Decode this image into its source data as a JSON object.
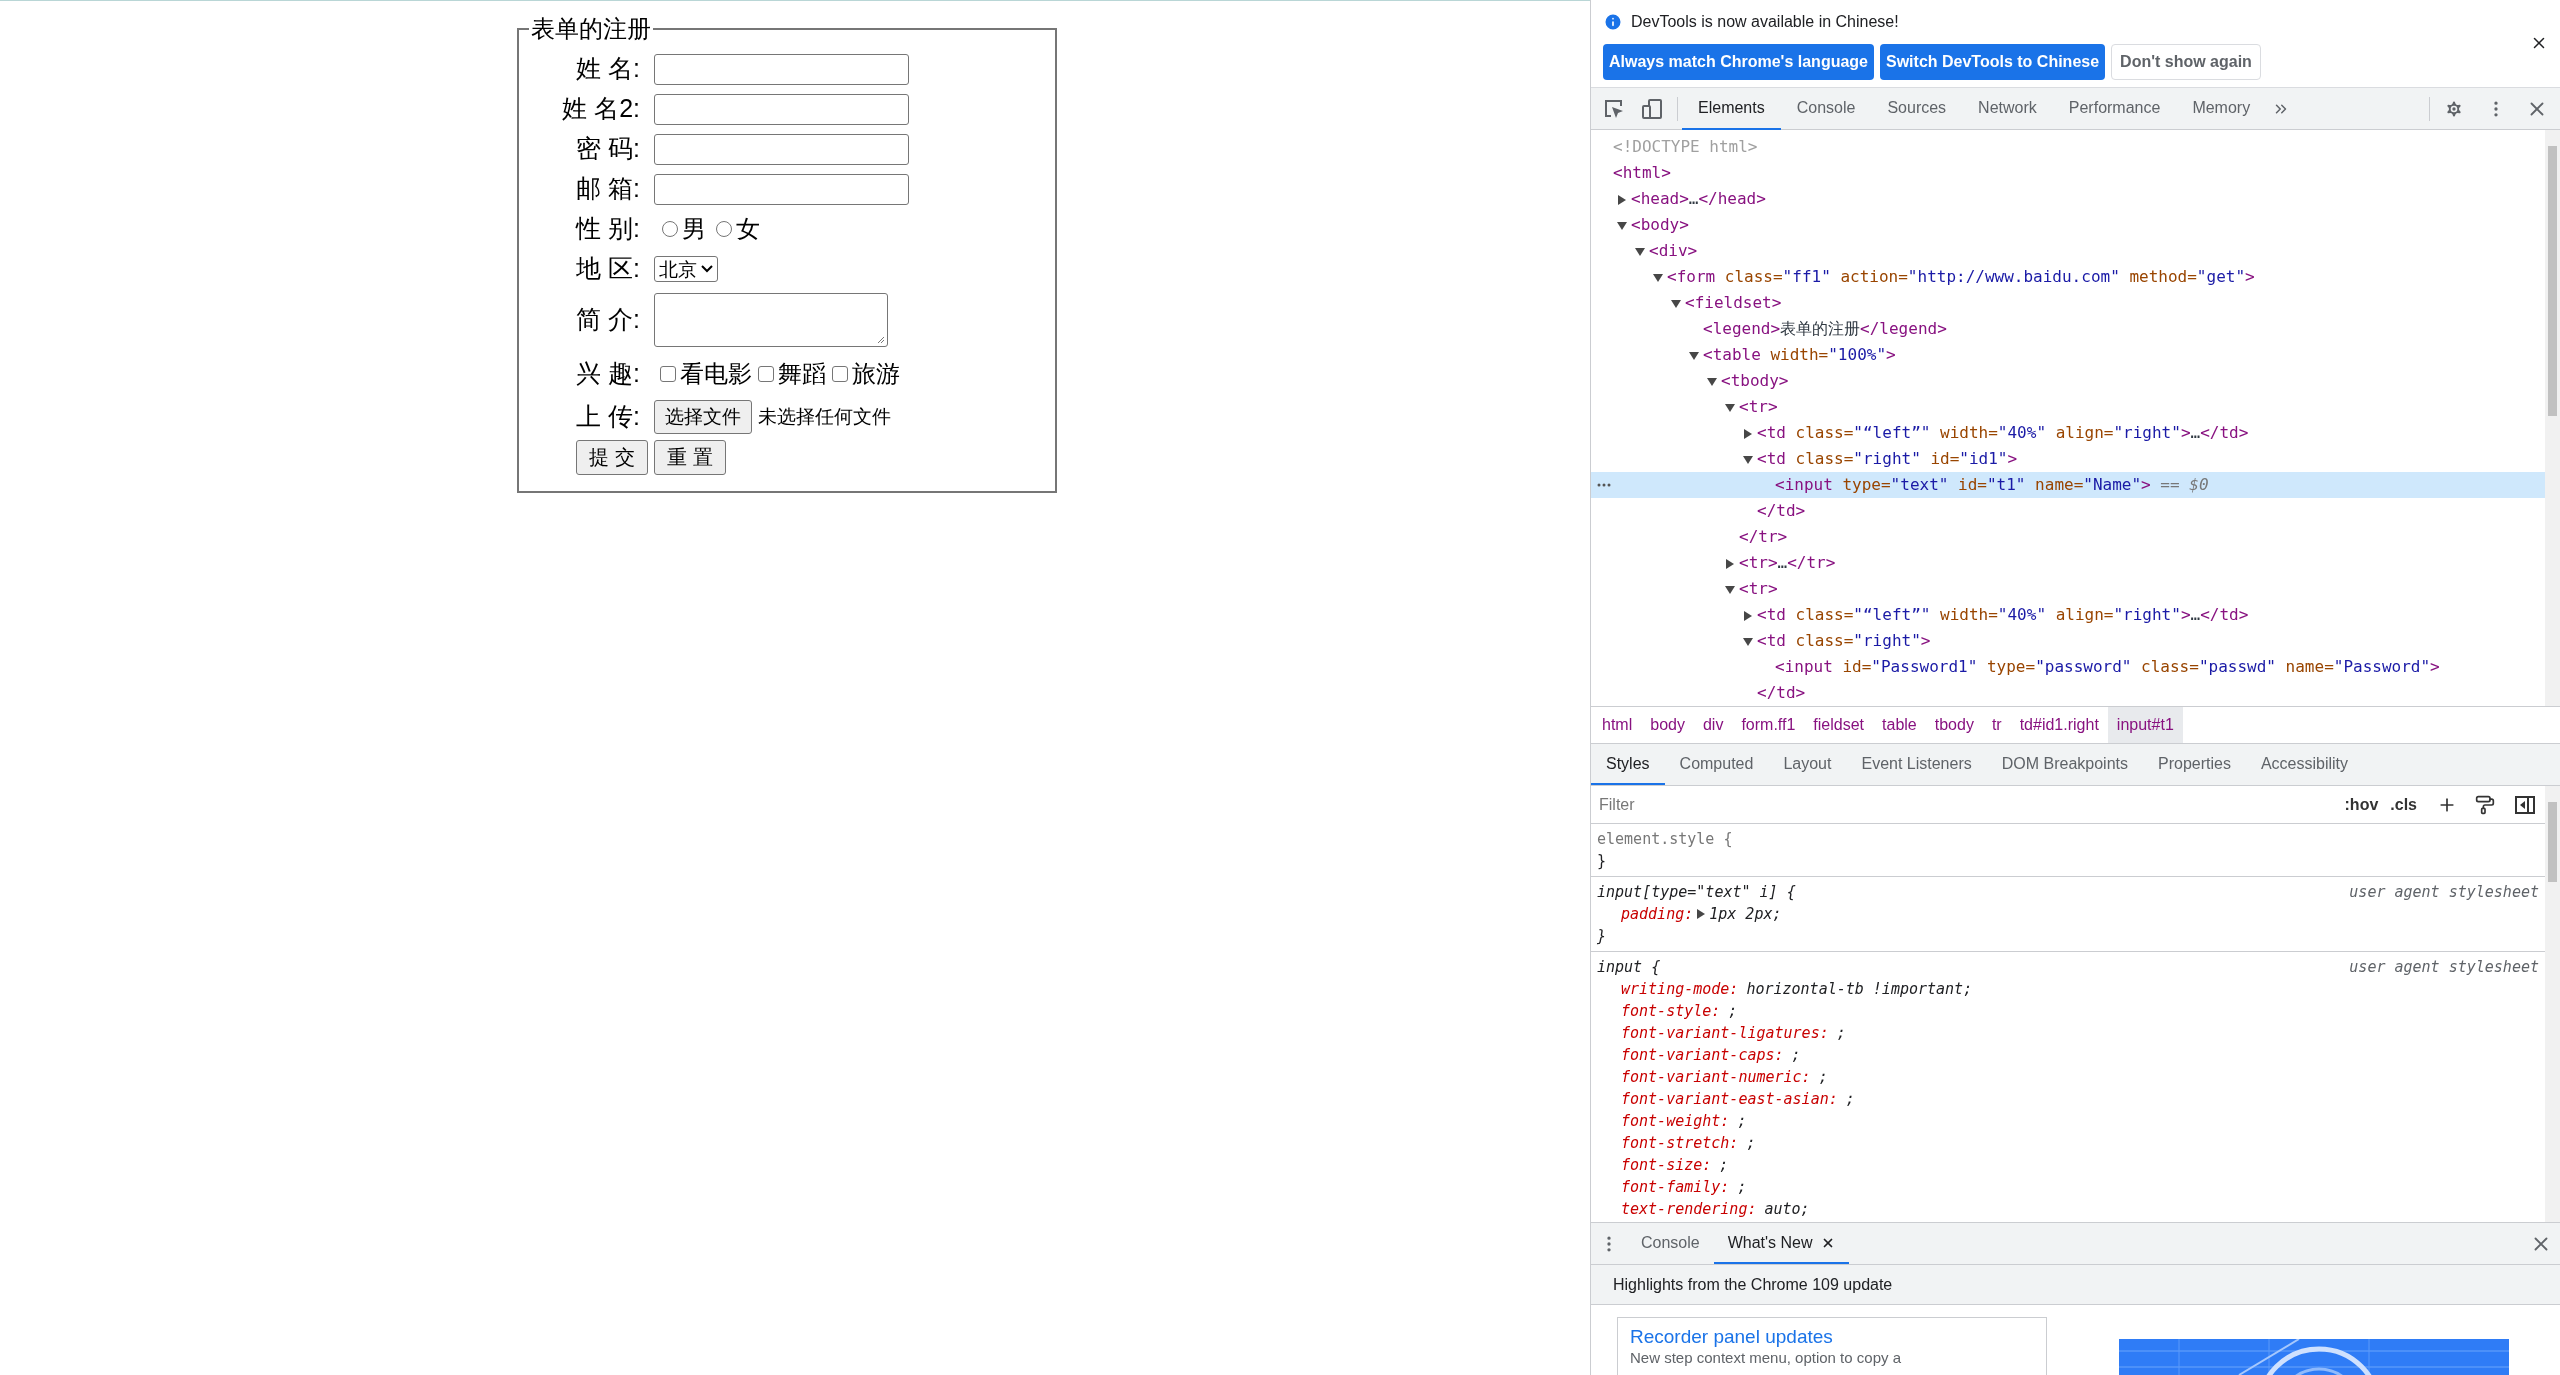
{
  "page": {
    "form": {
      "legend": "表单的注册",
      "rows": [
        {
          "kind": "text",
          "label": "姓 名:"
        },
        {
          "kind": "text",
          "label": "姓 名2:"
        },
        {
          "kind": "password",
          "label": "密 码:"
        },
        {
          "kind": "text",
          "label": "邮 箱:"
        },
        {
          "kind": "radio",
          "label": "性 别:",
          "options": [
            {
              "label": "男",
              "selected": false
            },
            {
              "label": "女",
              "selected": false
            }
          ]
        },
        {
          "kind": "select",
          "label": "地 区:",
          "value": "北京"
        },
        {
          "kind": "textarea",
          "label": "简 介:"
        },
        {
          "kind": "checkbox",
          "label": "兴 趣:",
          "options": [
            {
              "label": "看电影",
              "checked": false
            },
            {
              "label": "舞蹈",
              "checked": false
            },
            {
              "label": "旅游",
              "checked": false
            }
          ]
        },
        {
          "kind": "file",
          "label": "上 传:",
          "button": "选择文件",
          "status": "未选择任何文件"
        }
      ],
      "buttons": [
        "提 交",
        "重 置"
      ]
    }
  },
  "devtools": {
    "infobar": {
      "message": "DevTools is now available in Chinese!",
      "buttons": [
        {
          "label": "Always match Chrome's language",
          "kind": "primary"
        },
        {
          "label": "Switch DevTools to Chinese",
          "kind": "primary"
        },
        {
          "label": "Don't show again",
          "kind": "secondary"
        }
      ]
    },
    "tabs": [
      {
        "label": "Elements",
        "selected": true
      },
      {
        "label": "Console",
        "selected": false
      },
      {
        "label": "Sources",
        "selected": false
      },
      {
        "label": "Network",
        "selected": false
      },
      {
        "label": "Performance",
        "selected": false
      },
      {
        "label": "Memory",
        "selected": false
      }
    ],
    "dom_tree": [
      {
        "kind": "doctype",
        "text": "<!DOCTYPE html>",
        "selected": false
      },
      {
        "kind": "element",
        "text": "<html>",
        "selected": false,
        "children": [
          {
            "kind": "element",
            "text": "<head>…</head>",
            "expanded": false,
            "selected": false
          },
          {
            "kind": "element",
            "text": "<body>",
            "expanded": true,
            "selected": false,
            "children": [
              {
                "kind": "element",
                "text": "<div>",
                "expanded": true,
                "selected": false,
                "children": [
                  {
                    "kind": "element",
                    "text": "<form class=\"ff1\" action=\"http://www.baidu.com\" method=\"get\">",
                    "expanded": true,
                    "selected": false,
                    "children": [
                      {
                        "kind": "element",
                        "text": "<fieldset>",
                        "expanded": true,
                        "selected": false,
                        "children": [
                          {
                            "kind": "element",
                            "text": "<legend>表单的注册</legend>",
                            "selected": false
                          },
                          {
                            "kind": "element",
                            "text": "<table width=\"100%\">",
                            "expanded": true,
                            "selected": false,
                            "children": [
                              {
                                "kind": "element",
                                "text": "<tbody>",
                                "expanded": true,
                                "selected": false,
                                "children": [
                                  {
                                    "kind": "element",
                                    "text": "<tr>",
                                    "expanded": true,
                                    "selected": false,
                                    "close": "</tr>",
                                    "children": [
                                      {
                                        "kind": "element",
                                        "text": "<td class=\"“left”\" width=\"40%\" align=\"right\">…</td>",
                                        "expanded": false,
                                        "selected": false
                                      },
                                      {
                                        "kind": "element",
                                        "text": "<td class=\"right\" id=\"id1\">",
                                        "expanded": true,
                                        "selected": false,
                                        "close": "</td>",
                                        "children": [
                                          {
                                            "kind": "element",
                                            "text": "<input type=\"text\" id=\"t1\" name=\"Name\">",
                                            "selected": true,
                                            "suffix": "== $0"
                                          }
                                        ]
                                      }
                                    ]
                                  },
                                  {
                                    "kind": "element",
                                    "text": "<tr>…</tr>",
                                    "expanded": false,
                                    "selected": false
                                  },
                                  {
                                    "kind": "element",
                                    "text": "<tr>",
                                    "expanded": true,
                                    "selected": false,
                                    "children": [
                                      {
                                        "kind": "element",
                                        "text": "<td class=\"“left”\" width=\"40%\" align=\"right\">…</td>",
                                        "expanded": false,
                                        "selected": false
                                      },
                                      {
                                        "kind": "element",
                                        "text": "<td class=\"right\">",
                                        "expanded": true,
                                        "selected": false,
                                        "close": "</td>",
                                        "children": [
                                          {
                                            "kind": "element",
                                            "text": "<input id=\"Password1\" type=\"password\" class=\"passwd\" name=\"Password\">",
                                            "selected": false
                                          }
                                        ]
                                      }
                                    ]
                                  }
                                ]
                              }
                            ]
                          }
                        ]
                      }
                    ]
                  }
                ]
              }
            ]
          }
        ]
      }
    ],
    "breadcrumbs": [
      {
        "label": "html",
        "selected": false
      },
      {
        "label": "body",
        "selected": false
      },
      {
        "label": "div",
        "selected": false
      },
      {
        "label": "form.ff1",
        "selected": false
      },
      {
        "label": "fieldset",
        "selected": false
      },
      {
        "label": "table",
        "selected": false
      },
      {
        "label": "tbody",
        "selected": false
      },
      {
        "label": "tr",
        "selected": false
      },
      {
        "label": "td#id1.right",
        "selected": false
      },
      {
        "label": "input#t1",
        "selected": true
      }
    ],
    "styles_tabs": [
      {
        "label": "Styles",
        "selected": true
      },
      {
        "label": "Computed",
        "selected": false
      },
      {
        "label": "Layout",
        "selected": false
      },
      {
        "label": "Event Listeners",
        "selected": false
      },
      {
        "label": "DOM Breakpoints",
        "selected": false
      },
      {
        "label": "Properties",
        "selected": false
      },
      {
        "label": "Accessibility",
        "selected": false
      }
    ],
    "styles_filter": {
      "placeholder": "Filter"
    },
    "styles_toolbar": [
      ":hov",
      ".cls"
    ],
    "rules": [
      {
        "kind": "inline",
        "selector": "element.style {",
        "close": "}"
      },
      {
        "kind": "user-agent",
        "selector": "input[type=\"text\" i] {",
        "origin": "user agent stylesheet",
        "close": "}",
        "declarations": [
          {
            "property": "padding:",
            "value": "1px 2px;",
            "expandable": true
          }
        ]
      },
      {
        "kind": "user-agent",
        "selector": "input {",
        "origin": "user agent stylesheet",
        "declarations": [
          {
            "property": "writing-mode:",
            "value": "horizontal-tb !important;",
            "expandable": false
          },
          {
            "property": "font-style:",
            "value": ";",
            "expandable": false
          },
          {
            "property": "font-variant-ligatures:",
            "value": ";",
            "expandable": false
          },
          {
            "property": "font-variant-caps:",
            "value": ";",
            "expandable": false
          },
          {
            "property": "font-variant-numeric:",
            "value": ";",
            "expandable": false
          },
          {
            "property": "font-variant-east-asian:",
            "value": ";",
            "expandable": false
          },
          {
            "property": "font-weight:",
            "value": ";",
            "expandable": false
          },
          {
            "property": "font-stretch:",
            "value": ";",
            "expandable": false
          },
          {
            "property": "font-size:",
            "value": ";",
            "expandable": false
          },
          {
            "property": "font-family:",
            "value": ";",
            "expandable": false
          },
          {
            "property": "text-rendering:",
            "value": "auto;",
            "expandable": false
          }
        ]
      }
    ],
    "drawer": {
      "tabs": [
        {
          "label": "Console",
          "selected": false,
          "closable": false
        },
        {
          "label": "What's New",
          "selected": true,
          "closable": true
        }
      ],
      "heading": "Highlights from the Chrome 109 update",
      "card": {
        "title": "Recorder panel updates",
        "text": "New step context menu, option to copy a"
      }
    }
  }
}
